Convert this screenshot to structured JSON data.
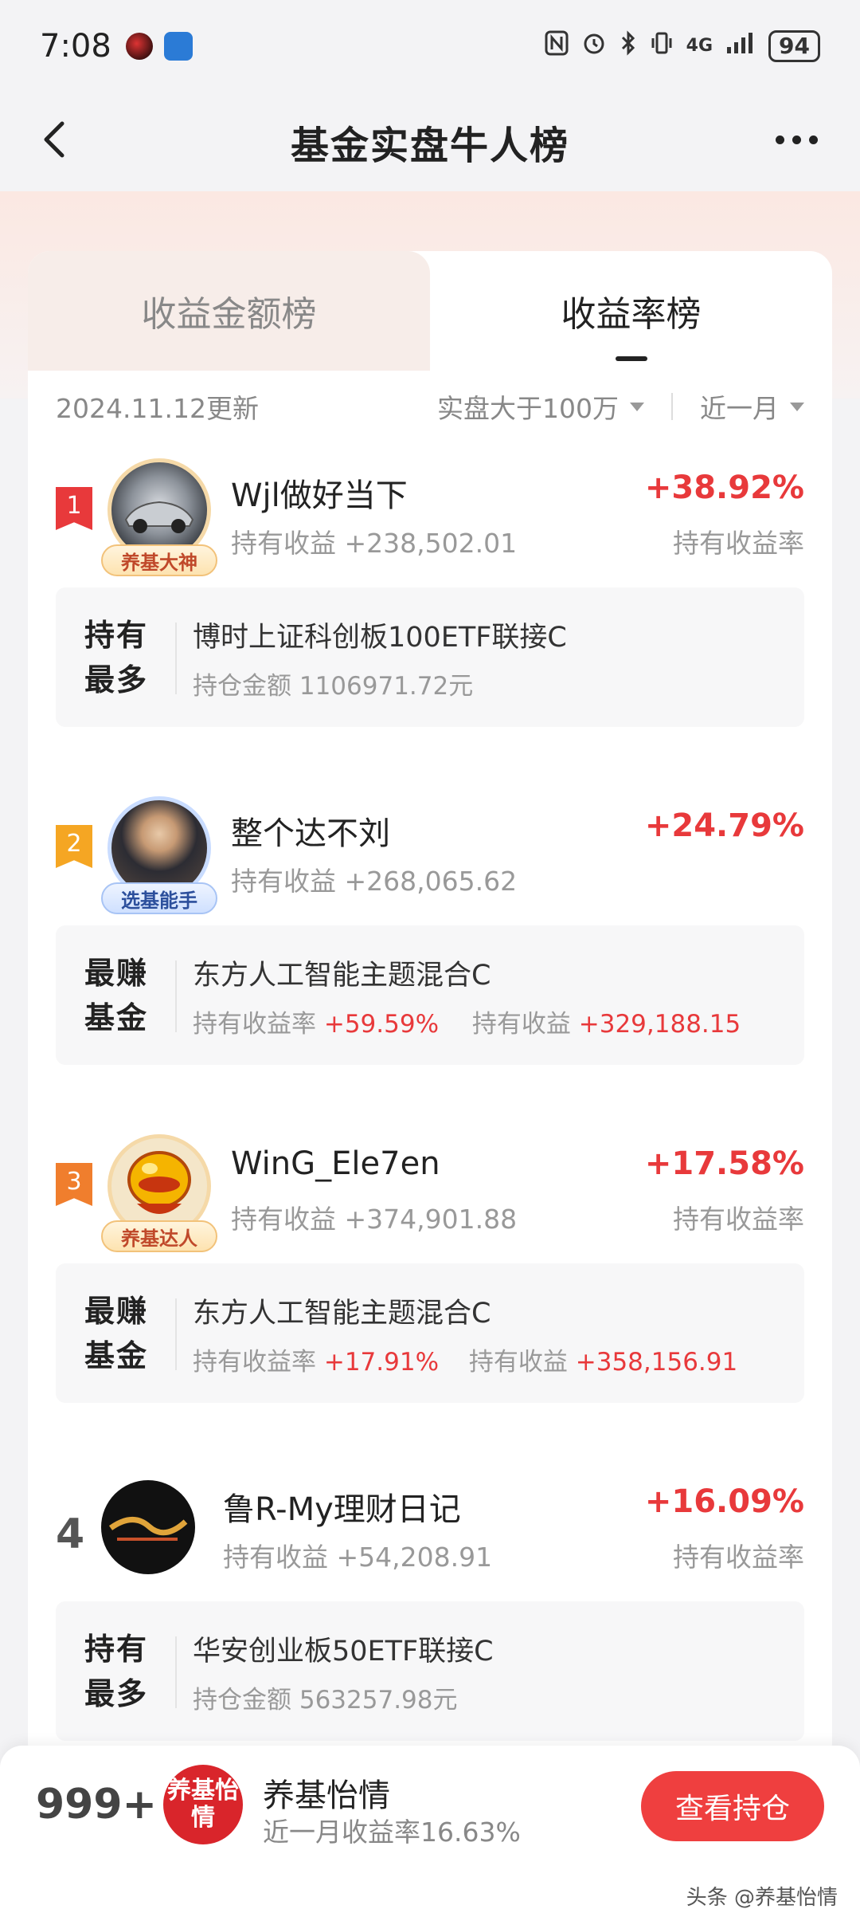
{
  "status": {
    "time": "7:08",
    "network": "4G",
    "battery": "94"
  },
  "nav": {
    "title": "基金实盘牛人榜"
  },
  "tabs": [
    {
      "label": "收益金额榜",
      "active": false
    },
    {
      "label": "收益率榜",
      "active": true
    }
  ],
  "filters": {
    "update": "2024.11.12更新",
    "amount": "实盘大于100万",
    "period": "近一月"
  },
  "entries": [
    {
      "rank": "1",
      "badge_color": "#e8393b",
      "name": "Wjl做好当下",
      "holding_label": "持有收益",
      "holding_value": "+238,502.01",
      "pct": "+38.92%",
      "pct_label": "持有收益率",
      "avatar_label": "养基大神",
      "fund_tag_1": "持有",
      "fund_tag_2": "最多",
      "fund_name": "博时上证科创板100ETF联接C",
      "fund_sub_1_label": "持仓金额",
      "fund_sub_1_value": "1106971.72元"
    },
    {
      "rank": "2",
      "badge_color": "#f5a623",
      "name": "整个达不刘",
      "holding_label": "持有收益",
      "holding_value": "+268,065.62",
      "pct": "+24.79%",
      "avatar_label": "选基能手",
      "fund_tag_1": "最赚",
      "fund_tag_2": "基金",
      "fund_name": "东方人工智能主题混合C",
      "fund_sub_1_label": "持有收益率",
      "fund_sub_1_value": "+59.59%",
      "fund_sub_2_label": "持有收益",
      "fund_sub_2_value": "+329,188.15"
    },
    {
      "rank": "3",
      "badge_color": "#f07e2d",
      "name": "WinG_Ele7en",
      "holding_label": "持有收益",
      "holding_value": "+374,901.88",
      "pct": "+17.58%",
      "pct_label": "持有收益率",
      "avatar_label": "养基达人",
      "fund_tag_1": "最赚",
      "fund_tag_2": "基金",
      "fund_name": "东方人工智能主题混合C",
      "fund_sub_1_label": "持有收益率",
      "fund_sub_1_value": "+17.91%",
      "fund_sub_2_label": "持有收益",
      "fund_sub_2_value": "+358,156.91"
    },
    {
      "rank": "4",
      "name": "鲁R-My理财日记",
      "holding_label": "持有收益",
      "holding_value": "+54,208.91",
      "pct": "+16.09%",
      "pct_label": "持有收益率",
      "fund_tag_1": "持有",
      "fund_tag_2": "最多",
      "fund_name": "华安创业板50ETF联接C",
      "fund_sub_1_label": "持仓金额",
      "fund_sub_1_value": "563257.98元"
    }
  ],
  "me": {
    "rank": "999+",
    "avatar_text": "养基怡情",
    "name": "养基怡情",
    "subtitle": "近一月收益率16.63%",
    "button": "查看持仓"
  },
  "watermark": "头条 @养基怡情",
  "colors": {
    "accent_red": "#e8393b",
    "button_red": "#ef3f3f"
  }
}
